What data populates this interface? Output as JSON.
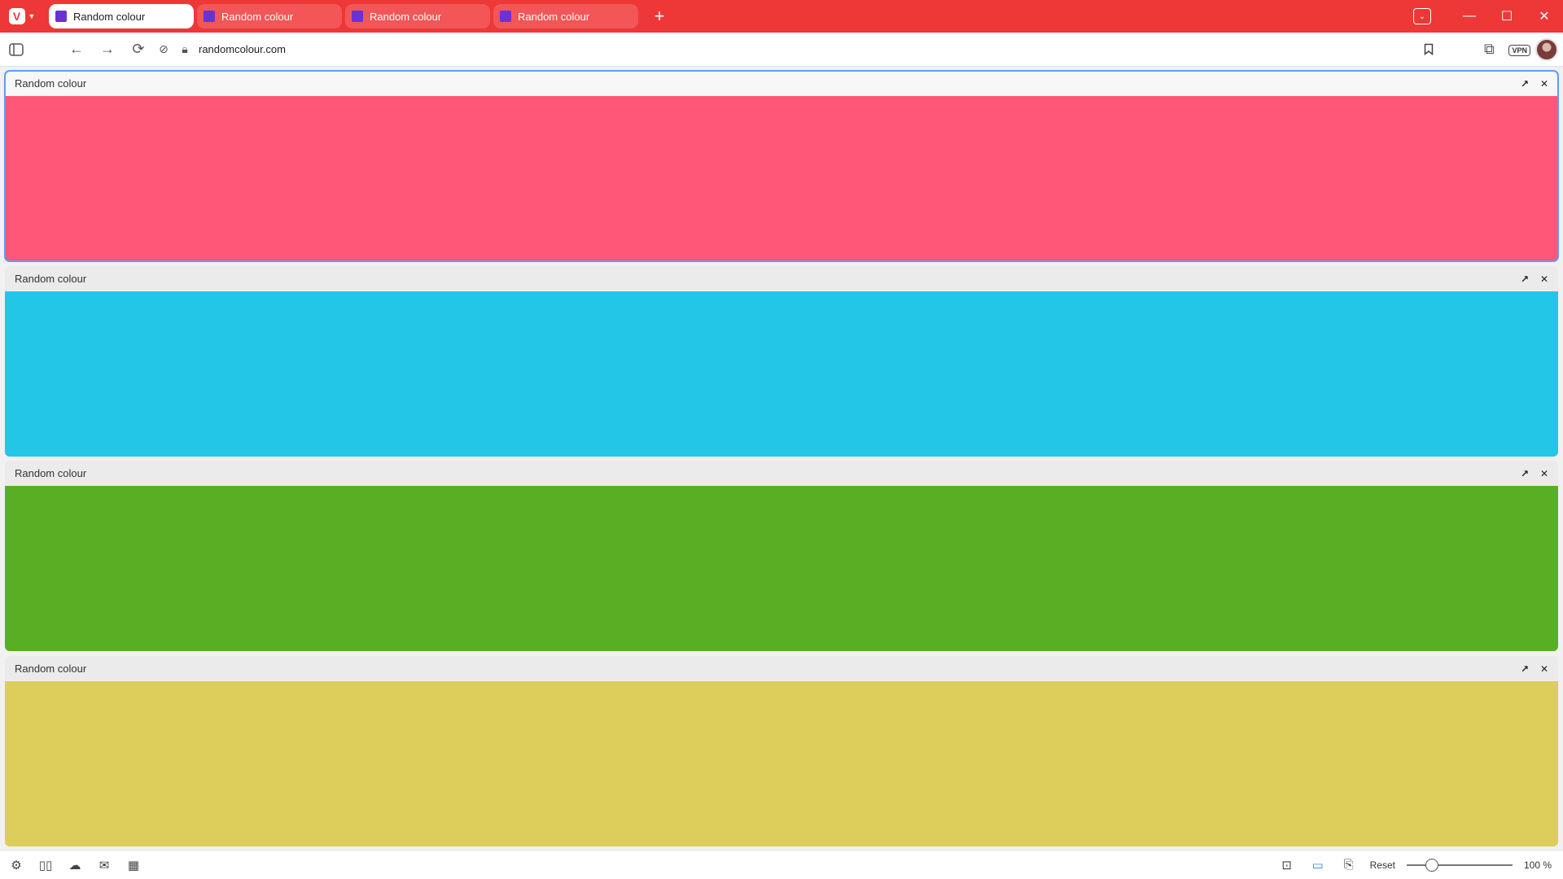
{
  "tabbar": {
    "tabs": [
      {
        "label": "Random colour",
        "active": true,
        "favicon_color": "#6a32d6"
      },
      {
        "label": "Random colour",
        "active": false,
        "favicon_color": "#6a32d6"
      },
      {
        "label": "Random colour",
        "active": false,
        "favicon_color": "#6a32d6"
      },
      {
        "label": "Random colour",
        "active": false,
        "favicon_color": "#6a32d6"
      }
    ],
    "accent_color": "#ee3838",
    "new_tab_icon": "plus-icon",
    "window_controls": [
      "minimize-icon",
      "maximize-icon",
      "close-icon"
    ]
  },
  "addressbar": {
    "url": "randomcolour.com",
    "icons": [
      "panel-toggle-icon",
      "back-icon",
      "forward-icon",
      "reload-icon",
      "tracker-blocker-icon",
      "lock-icon",
      "bookmark-icon",
      "extensions-icon"
    ],
    "vpn_label": "VPN"
  },
  "panes": [
    {
      "title": "Random colour",
      "color": "#ff5777",
      "focused": true
    },
    {
      "title": "Random colour",
      "color": "#24c6e8",
      "focused": false
    },
    {
      "title": "Random colour",
      "color": "#59af24",
      "focused": false
    },
    {
      "title": "Random colour",
      "color": "#ddcd5a",
      "focused": false
    }
  ],
  "statusbar": {
    "left_icons": [
      "settings-icon",
      "tile-view-icon",
      "sync-icon",
      "mail-icon",
      "calendar-icon"
    ],
    "right_icons": [
      "capture-icon",
      "page-tiling-icon",
      "page-actions-icon"
    ],
    "reset_label": "Reset",
    "zoom_level": "100 %",
    "zoom_fraction": 0.2
  }
}
